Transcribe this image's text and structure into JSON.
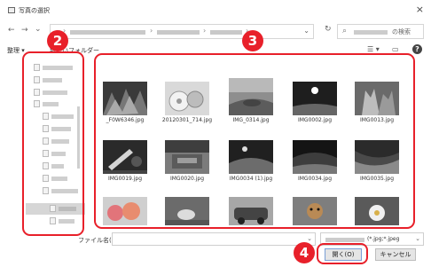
{
  "window": {
    "title": "写真の選択",
    "close_glyph": "×"
  },
  "address": {
    "back_glyph": "←",
    "forward_glyph": "→",
    "dropdown_glyph": "⌄",
    "refresh_glyph": "↻",
    "path_separator": "›"
  },
  "search": {
    "placeholder": "の検索",
    "icon": "search-icon"
  },
  "toolbar": {
    "organize_label": "整理 ▾",
    "new_folder_label": "新しいフォルダー",
    "help_label": "?"
  },
  "files": [
    {
      "name": "_F0W6346.jpg"
    },
    {
      "name": "20120301_714.jpg"
    },
    {
      "name": "IMG_0314.jpg"
    },
    {
      "name": "IMG0002.jpg"
    },
    {
      "name": "IMG0013.jpg"
    },
    {
      "name": "IMG0019.jpg"
    },
    {
      "name": "IMG0020.jpg"
    },
    {
      "name": "IMG0034 (1).jpg"
    },
    {
      "name": "IMG0034.jpg"
    },
    {
      "name": "IMG0035.jpg"
    },
    {
      "name": ""
    },
    {
      "name": ""
    },
    {
      "name": ""
    },
    {
      "name": ""
    },
    {
      "name": ""
    }
  ],
  "bottom": {
    "filename_label": "ファイル名(N):",
    "filename_value": "",
    "filter_value": "(*.jpg;*.jpeg",
    "open_label": "開く(O)",
    "cancel_label": "キャンセル"
  },
  "callouts": {
    "nav": "2",
    "files": "3",
    "open": "4"
  },
  "colors": {
    "callout": "#e8202a",
    "selected": "#d6d6d6"
  }
}
